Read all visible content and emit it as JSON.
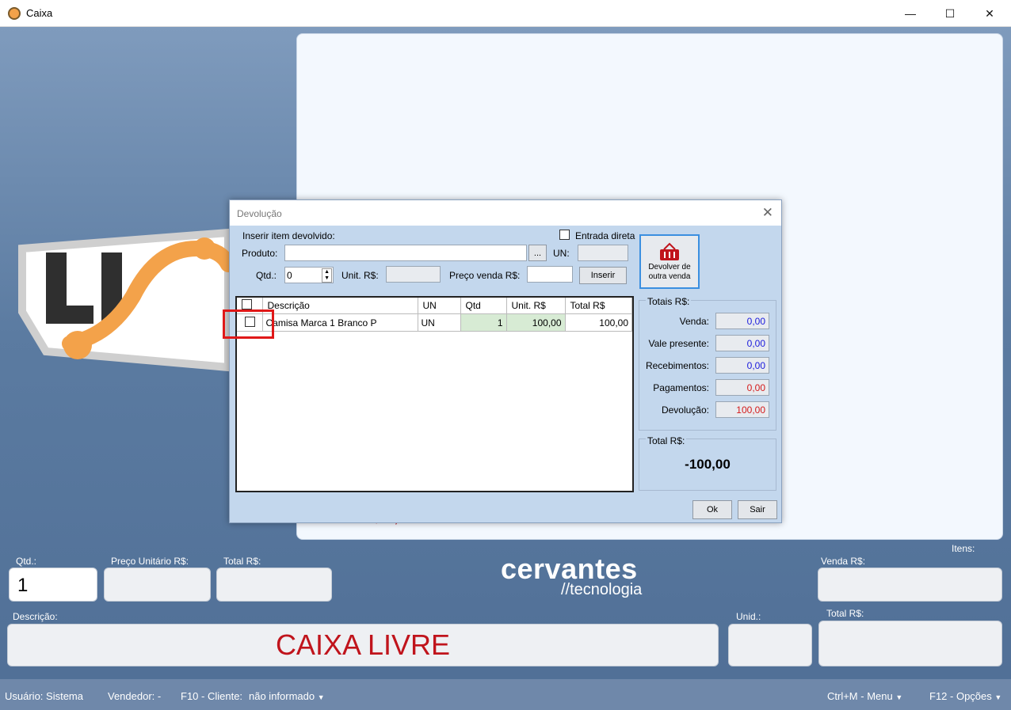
{
  "window": {
    "title": "Caixa"
  },
  "bottom": {
    "qtd_label": "Qtd.:",
    "qtd_value": "1",
    "preco_label": "Preço Unitário R$:",
    "total_label": "Total R$:",
    "descricao_label": "Descrição:",
    "descricao_value": "CAIXA LIVRE",
    "unid_label": "Unid.:",
    "itens_label": "Itens:",
    "venda_label": "Venda R$:",
    "total2_label": "Total R$:",
    "brand_line1": "cervantes",
    "brand_line2": "//tecnologia",
    "behind_text": "R$ 0,00"
  },
  "statusbar": {
    "usuario": "Usuário:  Sistema",
    "vendedor": "Vendedor:  -",
    "cliente_label": "F10 - Cliente:",
    "cliente_value": "não informado",
    "menu": "Ctrl+M - Menu",
    "opcoes": "F12 - Opções"
  },
  "dialog": {
    "title": "Devolução",
    "group_label": "Inserir item devolvido:",
    "entrada_direta": "Entrada direta",
    "produto_label": "Produto:",
    "browse_btn": "...",
    "un_label": "UN:",
    "qtd_label": "Qtd.:",
    "qtd_value": "0",
    "unit_label": "Unit. R$:",
    "preco_venda_label": "Preço venda R$:",
    "inserir_btn": "Inserir",
    "devolver_btn": "Devolver de outra venda",
    "columns": [
      "Descrição",
      "UN",
      "Qtd",
      "Unit. R$",
      "Total R$"
    ],
    "rows": [
      {
        "descricao": "Camisa Marca 1 Branco P",
        "un": "UN",
        "qtd": "1",
        "unit": "100,00",
        "total": "100,00"
      }
    ],
    "totais_label": "Totais R$:",
    "totais": [
      {
        "label": "Venda:",
        "value": "0,00",
        "color": "#1a1adc"
      },
      {
        "label": "Vale presente:",
        "value": "0,00",
        "color": "#1a1adc"
      },
      {
        "label": "Recebimentos:",
        "value": "0,00",
        "color": "#1a1adc"
      },
      {
        "label": "Pagamentos:",
        "value": "0,00",
        "color": "#d41a1a"
      },
      {
        "label": "Devolução:",
        "value": "100,00",
        "color": "#d41a1a"
      }
    ],
    "total_label": "Total R$:",
    "total_value": "-100,00",
    "ok_btn": "Ok",
    "sair_btn": "Sair"
  },
  "colors": {
    "accent_red": "#c0141c",
    "status_bar": "#6f88aa",
    "dialog_bg": "#c3d7ed"
  }
}
